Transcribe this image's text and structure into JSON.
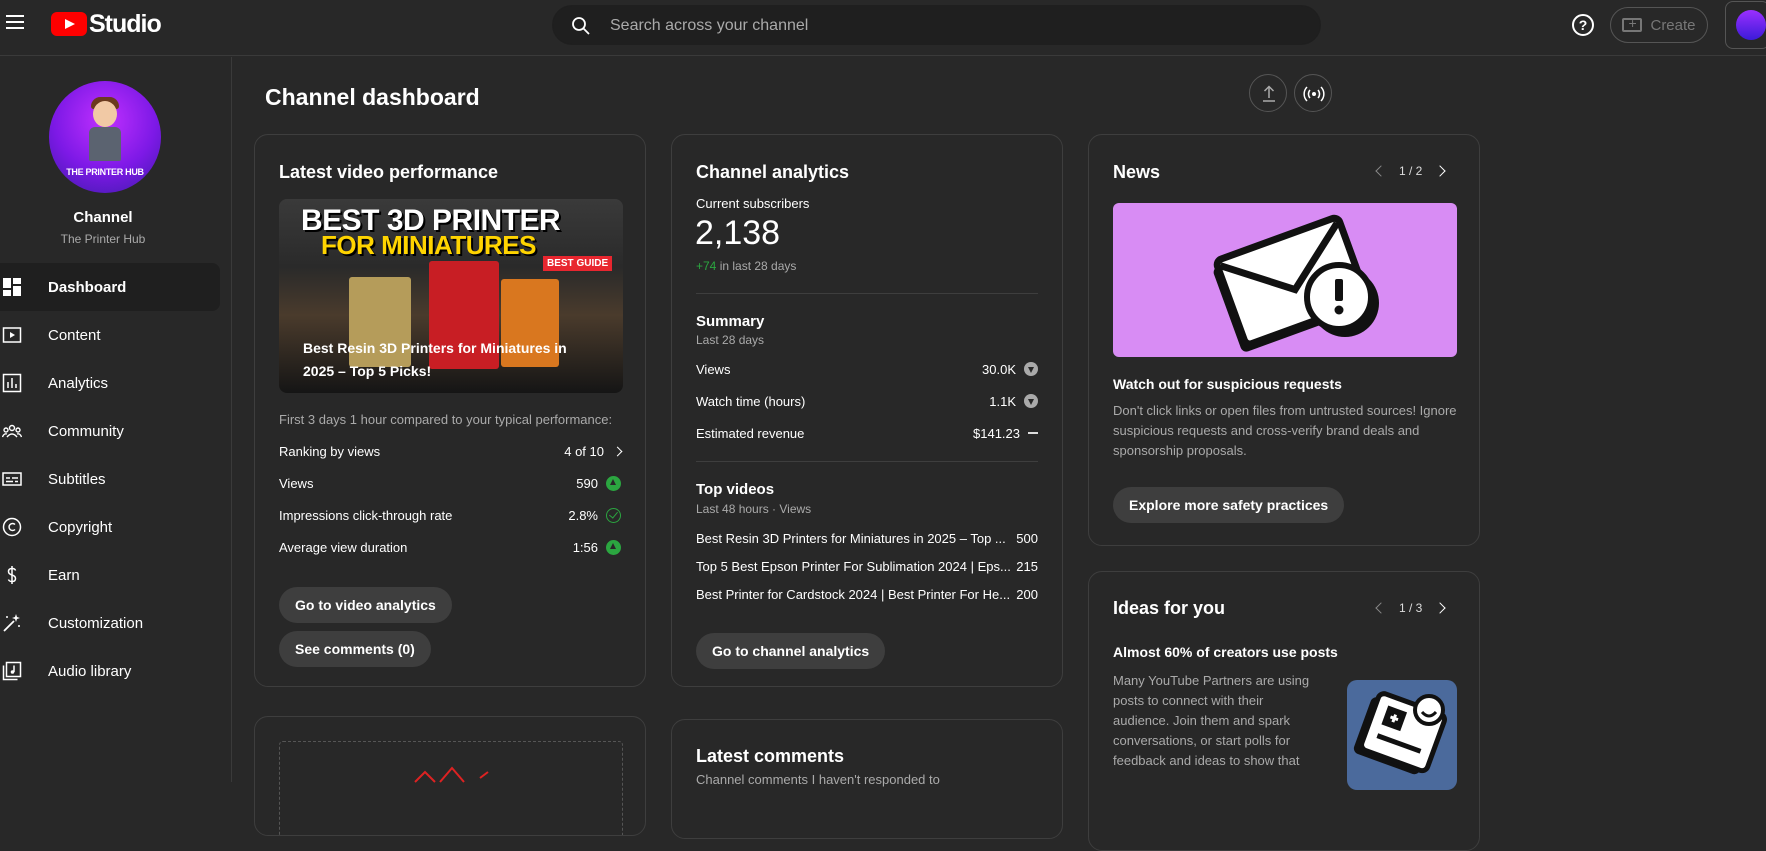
{
  "app": {
    "logo_text": "Studio"
  },
  "search": {
    "placeholder": "Search across your channel"
  },
  "header": {
    "create_label": "Create",
    "help_glyph": "?"
  },
  "channel": {
    "avatar_text": "THE PRINTER HUB",
    "title": "Channel",
    "name": "The Printer Hub"
  },
  "sidebar": {
    "items": [
      {
        "label": "Dashboard",
        "icon": "dashboard-icon"
      },
      {
        "label": "Content",
        "icon": "content-icon"
      },
      {
        "label": "Analytics",
        "icon": "analytics-icon"
      },
      {
        "label": "Community",
        "icon": "community-icon"
      },
      {
        "label": "Subtitles",
        "icon": "subtitles-icon"
      },
      {
        "label": "Copyright",
        "icon": "copyright-icon"
      },
      {
        "label": "Earn",
        "icon": "earn-icon"
      },
      {
        "label": "Customization",
        "icon": "customization-icon"
      },
      {
        "label": "Audio library",
        "icon": "audio-library-icon"
      }
    ]
  },
  "page": {
    "title": "Channel dashboard"
  },
  "latest_video": {
    "title": "Latest video performance",
    "thumb_line1": "BEST 3D PRINTER",
    "thumb_line2": "FOR MINIATURES",
    "thumb_badge": "BEST GUIDE",
    "video_title": "Best Resin 3D Printers for Miniatures in 2025 – Top 5 Picks!",
    "compare_text": "First 3 days 1 hour compared to your typical performance:",
    "rows": [
      {
        "label": "Ranking by views",
        "value": "4 of 10"
      },
      {
        "label": "Views",
        "value": "590"
      },
      {
        "label": "Impressions click-through rate",
        "value": "2.8%"
      },
      {
        "label": "Average view duration",
        "value": "1:56"
      }
    ],
    "btn_analytics": "Go to video analytics",
    "btn_comments": "See comments (0)"
  },
  "analytics": {
    "title": "Channel analytics",
    "subs_label": "Current subscribers",
    "subs_value": "2,138",
    "subs_delta": "+74",
    "subs_delta_suffix": " in last 28 days",
    "summary_title": "Summary",
    "summary_period": "Last 28 days",
    "summary_rows": [
      {
        "label": "Views",
        "value": "30.0K"
      },
      {
        "label": "Watch time (hours)",
        "value": "1.1K"
      },
      {
        "label": "Estimated revenue",
        "value": "$141.23"
      }
    ],
    "top_title": "Top videos",
    "top_period": "Last 48 hours · Views",
    "top_rows": [
      {
        "label": "Best Resin 3D Printers for Miniatures in 2025 – Top ...",
        "value": "500"
      },
      {
        "label": "Top 5 Best Epson Printer For Sublimation 2024 | Eps...",
        "value": "215"
      },
      {
        "label": "Best Printer for Cardstock 2024 | Best Printer For He...",
        "value": "200"
      }
    ],
    "btn": "Go to channel analytics"
  },
  "news": {
    "title": "News",
    "pager": "1 / 2",
    "headline": "Watch out for suspicious requests",
    "body": "Don't click links or open files from untrusted sources! Ignore suspicious requests and cross-verify brand deals and sponsorship proposals.",
    "btn": "Explore more safety practices"
  },
  "ideas": {
    "title": "Ideas for you",
    "pager": "1 / 3",
    "headline": "Almost 60% of creators use posts",
    "body": "Many YouTube Partners are using posts to connect with their audience. Join them and spark conversations, or start polls for feedback and ideas to show that"
  },
  "comments": {
    "title": "Latest comments",
    "subtitle": "Channel comments I haven't responded to"
  },
  "colors": {
    "accent": "#ff0000",
    "positive": "#2ba640",
    "news_bg": "#d88cf4"
  }
}
